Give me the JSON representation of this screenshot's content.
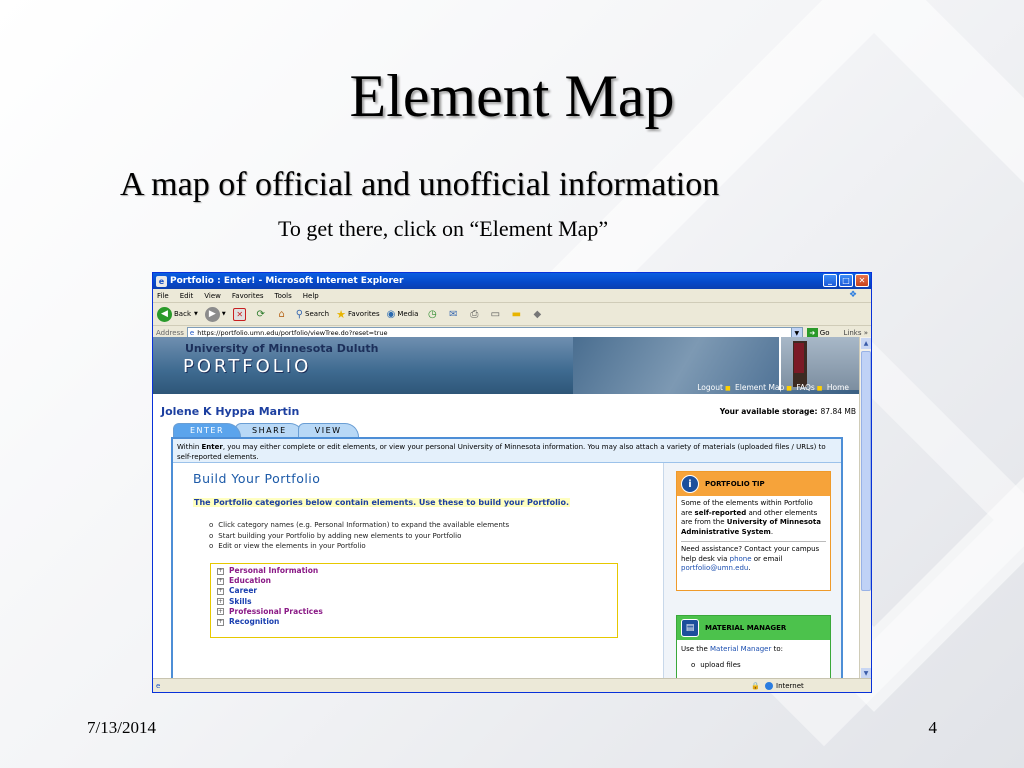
{
  "slide": {
    "title": "Element Map",
    "subtitle": "A map of official and unofficial information",
    "note": "To get there, click on “Element Map”",
    "date": "7/13/2014",
    "page_number": "4"
  },
  "browser": {
    "title": "Portfolio : Enter! - Microsoft Internet Explorer",
    "menu": [
      "File",
      "Edit",
      "View",
      "Favorites",
      "Tools",
      "Help"
    ],
    "toolbar": {
      "back": "Back",
      "search": "Search",
      "favorites": "Favorites",
      "media": "Media"
    },
    "address_label": "Address",
    "address_value": "https://portfolio.umn.edu/portfolio/viewTree.do?reset=true",
    "go_label": "Go",
    "links_label": "Links",
    "status_zone": "Internet"
  },
  "page": {
    "banner": {
      "university": "University of Minnesota Duluth",
      "portfolio": "PORTFOLIO",
      "nav": [
        "Logout",
        "Element Map",
        "FAQs",
        "Home"
      ]
    },
    "user_name": "Jolene K Hyppa Martin",
    "storage_label": "Your available storage:",
    "storage_value": "87.84 MB",
    "tabs": [
      "ENTER",
      "SHARE",
      "VIEW"
    ],
    "description_prefix": "Within ",
    "description_bold": "Enter",
    "description_rest": ", you may either complete or edit elements, or view your personal University of Minnesota information.  You may also attach a variety of materials (uploaded files / URLs) to self-reported elements.",
    "build_title": "Build Your Portfolio",
    "build_subtitle": "The Portfolio categories below contain elements.  Use these to build your Portfolio.",
    "steps": [
      "Click category names (e.g. Personal Information) to expand the available elements",
      "Start building your Portfolio by adding new elements to your Portfolio",
      "Edit or view the elements in your Portfolio"
    ],
    "categories": [
      "Personal Information",
      "Education",
      "Career",
      "Skills",
      "Professional Practices",
      "Recognition"
    ],
    "tip": {
      "header": "PORTFOLIO TIP",
      "t1": "Some of the elements within Portfolio are ",
      "t1_bold": "self-reported",
      "t2": " and other elements are from the ",
      "t2_bold": "University of Minnesota Administrative System",
      "t2_end": ".",
      "a1": "Need assistance?  Contact your campus help desk via ",
      "a_phone": "phone",
      "a2": " or email ",
      "a_email": "portfolio@umn.edu",
      "a3": "."
    },
    "material": {
      "header": "MATERIAL MANAGER",
      "use_prefix": "Use the ",
      "use_link": "Material Manager",
      "use_suffix": " to:",
      "item1": "upload files"
    }
  }
}
